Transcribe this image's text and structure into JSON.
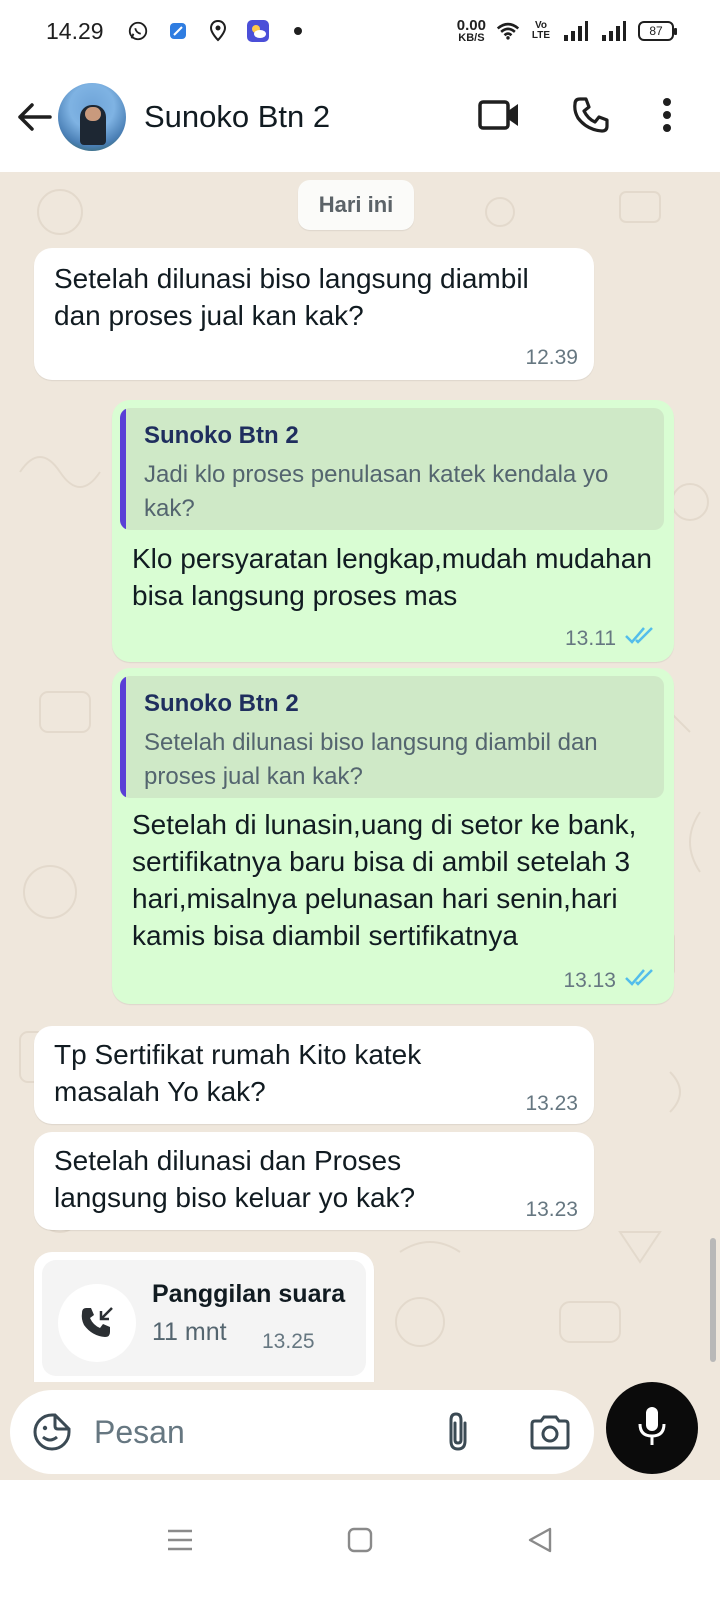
{
  "status_bar": {
    "time": "14.29",
    "net_speed_value": "0.00",
    "net_speed_unit": "KB/S",
    "volte": "Vo LTE",
    "battery": "87",
    "icons": [
      "whatsapp-icon",
      "app-icon",
      "location-icon",
      "weather-icon",
      "dot-icon",
      "wifi-icon",
      "signal-icon",
      "signal-icon",
      "battery-icon"
    ]
  },
  "header": {
    "contact_name": "Sunoko Btn 2",
    "icons": [
      "back-arrow-icon",
      "video-call-icon",
      "phone-icon",
      "more-vert-icon"
    ]
  },
  "chat": {
    "date_label": "Hari ini",
    "messages": [
      {
        "direction": "in",
        "text": "Setelah dilunasi biso langsung diambil dan proses jual kan kak?",
        "time": "12.39"
      },
      {
        "direction": "out",
        "quote_name": "Sunoko Btn 2",
        "quote_text": "Jadi klo proses penulasan katek kendala yo kak?",
        "text": "Klo persyaratan lengkap,mudah mudahan bisa langsung proses mas",
        "time": "13.11",
        "status": "read"
      },
      {
        "direction": "out",
        "quote_name": "Sunoko Btn 2",
        "quote_text": "Setelah dilunasi biso langsung diambil dan proses jual kan kak?",
        "text": "Setelah di lunasin,uang di setor ke bank, sertifikatnya baru bisa di ambil setelah 3 hari,misalnya pelunasan hari senin,hari kamis bisa diambil sertifikatnya",
        "time": "13.13",
        "status": "read"
      },
      {
        "direction": "in",
        "text": "Tp Sertifikat rumah Kito katek masalah Yo kak?",
        "time": "13.23"
      },
      {
        "direction": "in",
        "text": "Setelah dilunasi dan Proses langsung biso keluar yo kak?",
        "time": "13.23"
      }
    ],
    "call": {
      "title": "Panggilan suara",
      "duration": "11 mnt",
      "time": "13.25"
    }
  },
  "composer": {
    "placeholder": "Pesan",
    "icons": [
      "emoji-icon",
      "attach-icon",
      "camera-icon",
      "mic-icon"
    ]
  },
  "colors": {
    "outgoing_bubble": "#d9fdd3",
    "incoming_bubble": "#ffffff",
    "chat_background": "#efe7dc",
    "quote_bar": "#5a3fd6",
    "read_ticks": "#53bdeb"
  }
}
